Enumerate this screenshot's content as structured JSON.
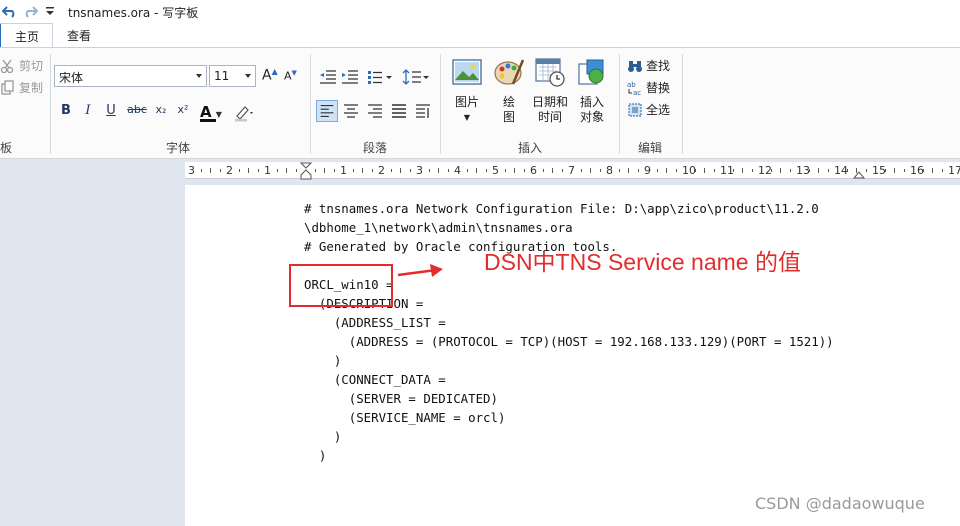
{
  "window": {
    "title": "tnsnames.ora - 写字板",
    "quick_access": [
      "undo-icon",
      "redo-icon",
      "customize-qa-icon"
    ]
  },
  "tabs": [
    {
      "label": "主页",
      "active": true
    },
    {
      "label": "查看",
      "active": false
    }
  ],
  "ribbon": {
    "clipboard": {
      "cut_label": "剪切",
      "copy_label": "复制",
      "group_label": "板"
    },
    "font": {
      "family": "宋体",
      "size": "11",
      "buttons": [
        "B",
        "I",
        "U",
        "abc",
        "x₂",
        "x²",
        "A"
      ],
      "group_label": "字体"
    },
    "paragraph": {
      "group_label": "段落"
    },
    "insert": {
      "picture_label": "图片",
      "paint_label_1": "绘",
      "paint_label_2": "图",
      "datetime_label_1": "日期和",
      "datetime_label_2": "时间",
      "object_label_1": "插入",
      "object_label_2": "对象",
      "group_label": "插入"
    },
    "edit": {
      "find_label": "查找",
      "replace_label": "替换",
      "select_all_label": "全选",
      "group_label": "编辑"
    }
  },
  "ruler": {
    "numbers": [
      "3",
      "2",
      "1",
      "1",
      "2",
      "3",
      "4",
      "5",
      "6",
      "7",
      "8",
      "9",
      "10",
      "11",
      "12",
      "13",
      "14",
      "15",
      "16",
      "17"
    ]
  },
  "document": {
    "lines": [
      "# tnsnames.ora Network Configuration File: D:\\app\\zico\\product\\11.2.0",
      "\\dbhome_1\\network\\admin\\tnsnames.ora",
      "# Generated by Oracle configuration tools.",
      "",
      "ORCL_win10 =",
      "  (DESCRIPTION =",
      "    (ADDRESS_LIST =",
      "      (ADDRESS = (PROTOCOL = TCP)(HOST = 192.168.133.129)(PORT = 1521))",
      "    )",
      "    (CONNECT_DATA =",
      "      (SERVER = DEDICATED)",
      "      (SERVICE_NAME = orcl)",
      "    )",
      "  )"
    ]
  },
  "annotation": {
    "text": "DSN中TNS Service name 的值",
    "color": "#e32d2d"
  },
  "watermark": "CSDN @dadaowuque",
  "colors": {
    "accent": "#2b6cb8",
    "ribbon_bg": "#fbfbfc",
    "workspace_bg": "#dfe6ef"
  }
}
